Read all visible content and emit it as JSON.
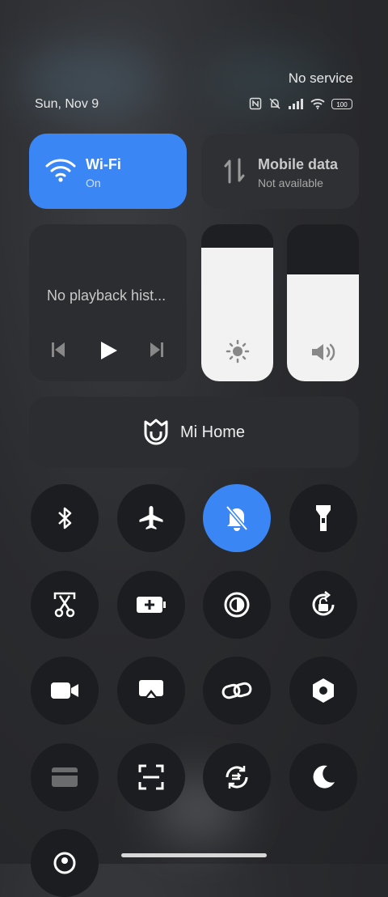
{
  "status_bar": {
    "carrier": "No service",
    "date": "Sun, Nov 9",
    "battery": "100",
    "icons": [
      "nfc-icon",
      "mute-icon",
      "signal-icon",
      "wifi-icon",
      "battery-icon"
    ]
  },
  "wifi_tile": {
    "title": "Wi-Fi",
    "status": "On"
  },
  "mobile_tile": {
    "title": "Mobile data",
    "status": "Not available"
  },
  "media_tile": {
    "text": "No playback hist..."
  },
  "brightness_slider": {
    "level": 0.85
  },
  "volume_slider": {
    "level": 0.68
  },
  "mihome_tile": {
    "label": "Mi Home"
  },
  "toggles": [
    {
      "name": "bluetooth",
      "active": false
    },
    {
      "name": "airplane-mode",
      "active": false
    },
    {
      "name": "silent-mode",
      "active": true
    },
    {
      "name": "flashlight",
      "active": false
    },
    {
      "name": "screenshot",
      "active": false
    },
    {
      "name": "battery-saver",
      "active": false
    },
    {
      "name": "reading-mode",
      "active": false
    },
    {
      "name": "auto-rotate",
      "active": false
    },
    {
      "name": "screen-recorder",
      "active": false
    },
    {
      "name": "cast",
      "active": false
    },
    {
      "name": "link",
      "active": false
    },
    {
      "name": "settings",
      "active": false
    },
    {
      "name": "card",
      "active": false
    },
    {
      "name": "scanner",
      "active": false
    },
    {
      "name": "sync",
      "active": false
    },
    {
      "name": "dark-mode",
      "active": false
    }
  ],
  "colors": {
    "accent": "#3a86f5",
    "tile_bg": "#2c2d31",
    "button_bg": "#1c1d20"
  }
}
